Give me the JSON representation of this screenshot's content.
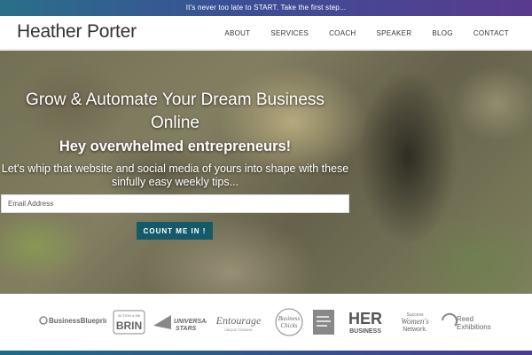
{
  "announcement": "It's never too late to START. Take the first step...",
  "site_title": "Heather Porter",
  "nav": [
    {
      "label": "ABOUT"
    },
    {
      "label": "SERVICES"
    },
    {
      "label": "COACH"
    },
    {
      "label": "SPEAKER"
    },
    {
      "label": "BLOG"
    },
    {
      "label": "CONTACT"
    }
  ],
  "hero": {
    "headline": "Grow & Automate Your Dream Business Online",
    "subheadline": "Hey overwhelmed entrepreneurs!",
    "tagline": "Let's whip that website and social media of yours into shape with these sinfully easy weekly tips...",
    "email_placeholder": "Email Address",
    "cta_label": "COUNT ME IN !"
  },
  "featured_logos": [
    {
      "name": "BusinessBlueprint"
    },
    {
      "name": "BRIN",
      "small": "ACTION a 5th"
    },
    {
      "name": "UNIVERSAL STARS"
    },
    {
      "name": "Entourage",
      "small": "UNIQUE TRAINING"
    },
    {
      "name": "Business Chicks"
    },
    {
      "name": "book"
    },
    {
      "name": "HER",
      "small": "BUSINESS"
    },
    {
      "name": "Success Women's Network."
    },
    {
      "name": "Reed Exhibitions"
    }
  ],
  "colors": {
    "cta": "#155a68",
    "bar_start": "#2a6f8a",
    "bar_end": "#5a3a8e"
  }
}
